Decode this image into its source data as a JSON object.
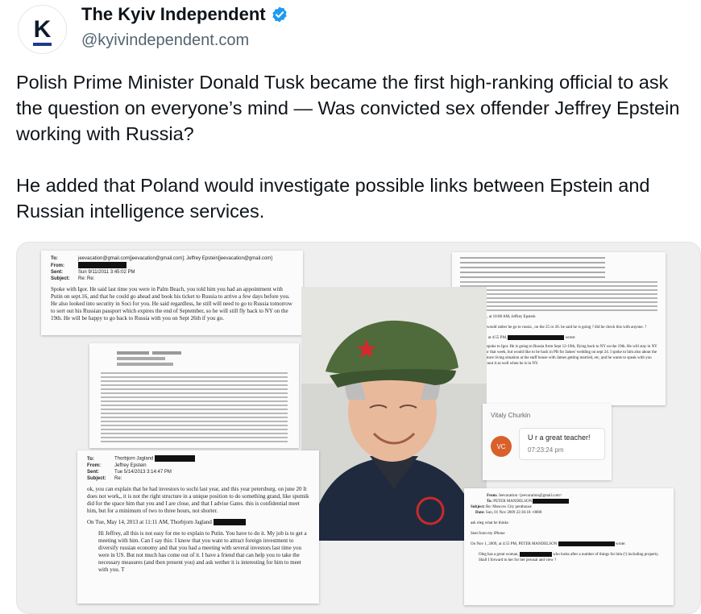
{
  "account": {
    "name": "The Kyiv Independent",
    "handle": "@kyivindependent.com",
    "avatar_letter": "K",
    "verified_icon": "verified-badge-icon",
    "accent": "#1d9bf0"
  },
  "post": {
    "paragraph1": "Polish Prime Minister Donald Tusk became the first high-ranking official to ask the question on everyone’s mind — Was convicted sex offender Jeffrey Epstein working with Russia?",
    "paragraph2": "He added that Poland would investigate possible links between Epstein and Russian intelligence services."
  },
  "media": {
    "doc1": {
      "to_label": "To:",
      "to": "jeevacation@gmail.com[jeevacation@gmail.com]; Jeffrey Epstein[jeevacation@gmail.com]",
      "from_label": "From:",
      "sent_label": "Sent:",
      "sent": "Sun 9/11/2011 3:45:02 PM",
      "subject_label": "Subject:",
      "subject": "Re: Re:",
      "body": "Spoke with Igor. He said last time you were in Palm Beach, you told him you had an appointment with Putin on sept.16, and that he could go ahead and book his ticket to Russia to arrive a few days before you. He also looked into security in Soci for you. He said regardless, he still will need to go to Russia tomorrow to sort out his Russian passport which expires the end of September, so he will still fly back to NY on the 19th. He will be happy to go back to Russia with you on Sept 26th if you go."
    },
    "doc4": {
      "to_label": "To:",
      "to": "Thorbjorn Jagland",
      "from_label": "From:",
      "from": "Jeffrey Epstein",
      "sent_label": "Sent:",
      "sent": "Tue 5/14/2013 3:14:47 PM",
      "subject_label": "Subject:",
      "subject": "Re:",
      "body": "ok, you can explain that he had investors to sochi last year, and this year petersburg. on june 20  It does not work,, it is not the right structure in a unique position to do something grand, like sputnik did for the space him that you and I are close, and that I advise Gates. this is confidential meet him, but for a minimum of two to three hours, not shorter.",
      "line2": "On Tue, May 14, 2013 at 11:11 AM, Thorbjorn Jagland",
      "body2": "Hi Jeffrey, all this is not easy for me to explain to Putin. You have to do it. My job is to get a meeting with him. Can I say this: I know that you want to attract foreign investment to diversify russian economy and that you had a meeting with several investors last time you were in US. But not much has come out of it. I have a friend that can help you to take the necessary measures (and then present you) and ask wether it is interesting for him to meet with you. T"
    },
    "chat": {
      "contact": "Vitaly Churkin",
      "message": "U r a great teacher!",
      "time": "07:23:24 pm",
      "initials": "VC"
    },
    "doc5": {
      "from_label": "From:",
      "from": "Jeevacation <jeevacation@gmail.com>",
      "to_label": "To:",
      "to": "PETER MANDELSON",
      "subject_label": "Subject:",
      "subject": "Re: Moscow City penthouse",
      "date_label": "Date:",
      "date": "Sun, 01 Nov 2009 22:36:18 +0000",
      "line1": "ask oleg what he thinks",
      "line2": "Sent from my iPhone",
      "line3": "On Nov 1, 2009, at 4:55 PM, PETER MANDELSON",
      "line3b": "wrote:",
      "line4": "Oleg has a great woman,",
      "line4b": "who looks after a number of things for him (!) including property. Shall I forward to her for her perusal and view ?"
    },
    "doc3": {
      "line1": "I would rather he go to russia , on the 25 or 26.   he said he is going ?   did he check this with anyone. ?",
      "line2": "On Sep 11, 2011, at 10:08 AM, Jeffrey Epstein",
      "line3": "On Sep 10, 2011 at 4:55 PM,",
      "line3b": "wrote:",
      "body": "I spoke to Igor. He is going to Russia from Sept 12-19th, flying back to NY on the 19th. He will stay in NY for that week, but would like to be back in PB for James' wedding on sept 24. I spoke to him also about the future living situation at the staff house with James getting married, etc, and he wants to speak with you about it as well when he is in NY."
    }
  }
}
